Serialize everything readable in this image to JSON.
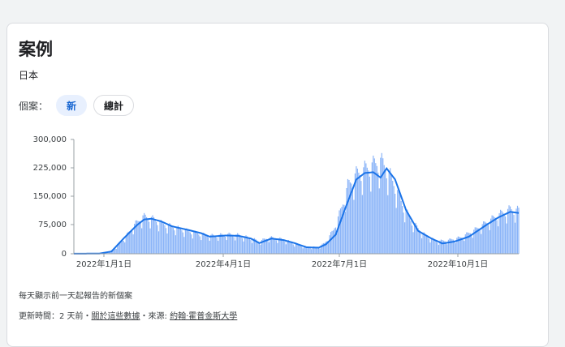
{
  "card": {
    "title": "案例",
    "subtitle": "日本",
    "filter_label": "個案：",
    "chips": [
      {
        "label": "新",
        "selected": true
      },
      {
        "label": "總計",
        "selected": false
      }
    ],
    "footer_note": "每天顯示前一天起報告的新個案",
    "updated_prefix": "更新時間：2 天前・",
    "about_link": "關於這些數據",
    "source_prefix": "・來源: ",
    "source_link": "約翰·霍普金斯大學"
  },
  "colors": {
    "bar": "#8ab4f8",
    "line": "#1a73e8",
    "chip_selected_bg": "#e8f0fe",
    "chip_selected_text": "#1967d2"
  },
  "chart_data": {
    "type": "bar",
    "y_tick_labels": [
      "300,000",
      "225,000",
      "150,000",
      "75,000",
      "0"
    ],
    "y_ticks": [
      300000,
      225000,
      150000,
      75000,
      0
    ],
    "ylim": [
      0,
      300000
    ],
    "x_tick_labels": [
      "2022年1月1日",
      "2022年4月1日",
      "2022年7月1日",
      "2022年10月1日"
    ],
    "x_ticks": [
      "2022-01-01",
      "2022-04-01",
      "2022-07-01",
      "2022-10-01"
    ],
    "x_start": "2021-12-10",
    "x_end": "2022-12-12",
    "grid": false,
    "series": [
      {
        "kind": "daily-bars",
        "points": [
          [
            "2021-12-10",
            200
          ],
          [
            "2021-12-20",
            300
          ],
          [
            "2021-12-31",
            500
          ],
          [
            "2022-01-08",
            4000
          ],
          [
            "2022-01-15",
            20000
          ],
          [
            "2022-01-22",
            45000
          ],
          [
            "2022-01-29",
            75000
          ],
          [
            "2022-02-05",
            96000
          ],
          [
            "2022-02-12",
            92000
          ],
          [
            "2022-02-19",
            80000
          ],
          [
            "2022-03-01",
            70000
          ],
          [
            "2022-03-15",
            58000
          ],
          [
            "2022-03-25",
            50000
          ],
          [
            "2022-04-05",
            46000
          ],
          [
            "2022-04-15",
            50000
          ],
          [
            "2022-04-25",
            48000
          ],
          [
            "2022-05-05",
            40000
          ],
          [
            "2022-05-12",
            32000
          ],
          [
            "2022-05-20",
            42000
          ],
          [
            "2022-06-01",
            37000
          ],
          [
            "2022-06-10",
            26000
          ],
          [
            "2022-06-20",
            17000
          ],
          [
            "2022-06-30",
            17000
          ],
          [
            "2022-07-05",
            28000
          ],
          [
            "2022-07-12",
            60000
          ],
          [
            "2022-07-18",
            110000
          ],
          [
            "2022-07-24",
            175000
          ],
          [
            "2022-07-31",
            205000
          ],
          [
            "2022-08-07",
            218000
          ],
          [
            "2022-08-14",
            230000
          ],
          [
            "2022-08-20",
            240000
          ],
          [
            "2022-08-25",
            220000
          ],
          [
            "2022-09-01",
            175000
          ],
          [
            "2022-09-08",
            120000
          ],
          [
            "2022-09-15",
            82000
          ],
          [
            "2022-09-25",
            50000
          ],
          [
            "2022-10-05",
            32000
          ],
          [
            "2022-10-15",
            35000
          ],
          [
            "2022-10-25",
            42000
          ],
          [
            "2022-11-05",
            60000
          ],
          [
            "2022-11-15",
            80000
          ],
          [
            "2022-11-25",
            100000
          ],
          [
            "2022-12-05",
            115000
          ],
          [
            "2022-12-12",
            112000
          ]
        ]
      },
      {
        "kind": "7-day-average-line",
        "points": [
          [
            "2021-12-10",
            200
          ],
          [
            "2021-12-31",
            600
          ],
          [
            "2022-01-10",
            6000
          ],
          [
            "2022-01-20",
            40000
          ],
          [
            "2022-01-31",
            75000
          ],
          [
            "2022-02-06",
            90000
          ],
          [
            "2022-02-12",
            92000
          ],
          [
            "2022-02-20",
            85000
          ],
          [
            "2022-03-01",
            72000
          ],
          [
            "2022-03-15",
            62000
          ],
          [
            "2022-03-25",
            54000
          ],
          [
            "2022-04-01",
            45000
          ],
          [
            "2022-04-15",
            48000
          ],
          [
            "2022-04-25",
            47000
          ],
          [
            "2022-05-05",
            40000
          ],
          [
            "2022-05-12",
            28000
          ],
          [
            "2022-05-22",
            40000
          ],
          [
            "2022-06-01",
            36000
          ],
          [
            "2022-06-10",
            28000
          ],
          [
            "2022-06-20",
            17000
          ],
          [
            "2022-06-30",
            16000
          ],
          [
            "2022-07-06",
            25000
          ],
          [
            "2022-07-14",
            50000
          ],
          [
            "2022-07-22",
            120000
          ],
          [
            "2022-07-31",
            195000
          ],
          [
            "2022-08-07",
            212000
          ],
          [
            "2022-08-14",
            214000
          ],
          [
            "2022-08-20",
            200000
          ],
          [
            "2022-08-25",
            224000
          ],
          [
            "2022-09-01",
            195000
          ],
          [
            "2022-09-10",
            115000
          ],
          [
            "2022-09-20",
            60000
          ],
          [
            "2022-10-01",
            40000
          ],
          [
            "2022-10-10",
            27000
          ],
          [
            "2022-10-20",
            32000
          ],
          [
            "2022-11-01",
            45000
          ],
          [
            "2022-11-15",
            75000
          ],
          [
            "2022-11-25",
            95000
          ],
          [
            "2022-12-05",
            110000
          ],
          [
            "2022-12-12",
            107000
          ]
        ]
      }
    ]
  }
}
